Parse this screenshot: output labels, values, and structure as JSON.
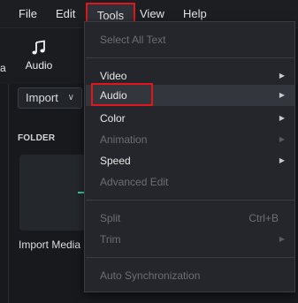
{
  "menubar": {
    "file": "File",
    "edit": "Edit",
    "tools": "Tools",
    "view": "View",
    "help": "Help"
  },
  "app": {
    "audio_tab_label": "Audio",
    "edge_tab_label": "a",
    "import_button": "Import",
    "folder_header": "FOLDER",
    "media_label": "Import Media"
  },
  "tools_menu": {
    "select_all_text": "Select All Text",
    "video": "Video",
    "audio": "Audio",
    "color": "Color",
    "animation": "Animation",
    "speed": "Speed",
    "advanced_edit": "Advanced Edit",
    "split": "Split",
    "split_shortcut": "Ctrl+B",
    "trim": "Trim",
    "auto_sync": "Auto Synchronization"
  },
  "colors": {
    "highlight_outline": "#e0161c",
    "accent_green": "#2fd0b0"
  }
}
